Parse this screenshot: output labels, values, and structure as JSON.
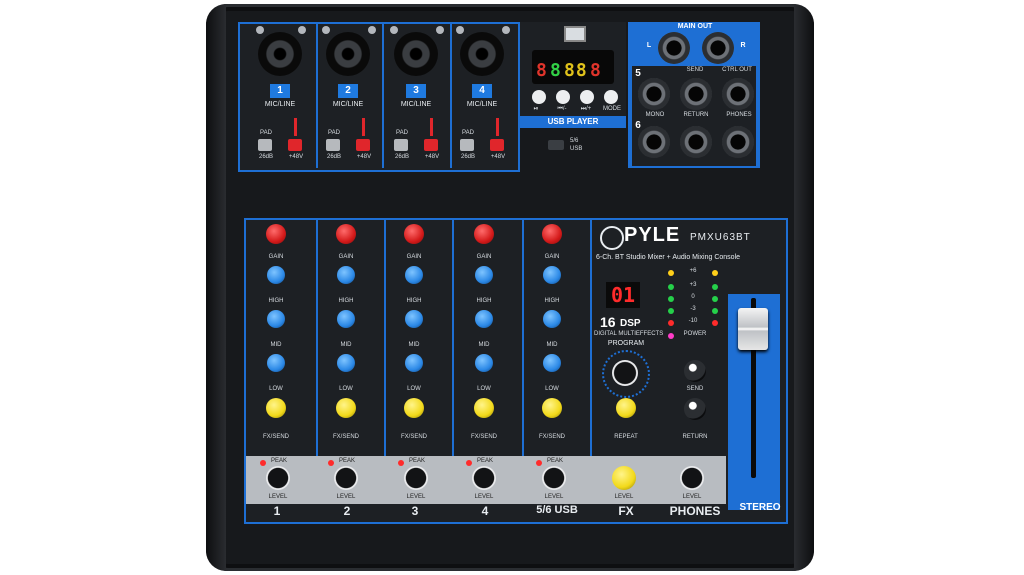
{
  "brand": {
    "logo_text": "PYLE",
    "model": "PMXU63BT",
    "subtitle": "6-Ch. BT Studio Mixer + Audio Mixing Console"
  },
  "channels": [
    {
      "number": "1",
      "type": "MIC/LINE",
      "pad": "PAD",
      "pad_value": "26dB",
      "phantom": "+48V",
      "footer": "1"
    },
    {
      "number": "2",
      "type": "MIC/LINE",
      "pad": "PAD",
      "pad_value": "26dB",
      "phantom": "+48V",
      "footer": "2"
    },
    {
      "number": "3",
      "type": "MIC/LINE",
      "pad": "PAD",
      "pad_value": "26dB",
      "phantom": "+48V",
      "footer": "3"
    },
    {
      "number": "4",
      "type": "MIC/LINE",
      "pad": "PAD",
      "pad_value": "26dB",
      "phantom": "+48V",
      "footer": "4"
    }
  ],
  "strip_labels": {
    "gain": "GAIN",
    "high": "HIGH",
    "mid": "MID",
    "low": "LOW",
    "fx_send": "FX/SEND",
    "peak": "PEAK",
    "level": "LEVEL"
  },
  "footers": {
    "ch56": "5/6 USB",
    "fx": "FX",
    "phones": "PHONES",
    "stereo": "STEREO"
  },
  "usb_player": {
    "title": "USB PLAYER",
    "buttons": [
      "⏯",
      "⏮/-",
      "⏭/+",
      "MODE"
    ],
    "source_5_6": "5/6",
    "source_usb": "USB"
  },
  "io": {
    "main_out": "MAIN OUT",
    "left": "L",
    "right": "R",
    "send": "SEND",
    "ctrl_out": "CTRL OUT",
    "return": "RETURN",
    "phones": "PHONES",
    "mono": "MONO",
    "ch5": "5",
    "ch6": "6"
  },
  "dsp": {
    "display": "01",
    "count": "16",
    "label": "DSP",
    "sub": "DIGITAL MULTIEFFECTS",
    "program": "PROGRAM",
    "repeat": "REPEAT",
    "send": "SEND",
    "return": "RETURN"
  },
  "meter": {
    "marks": [
      "+6",
      "+3",
      "0",
      "-3",
      "-10"
    ],
    "power": "POWER"
  },
  "colors": {
    "accent_blue": "#1e6fd4",
    "knob_red": "#d41a1a",
    "knob_blue": "#2b88e6",
    "knob_yellow": "#f2d91a",
    "body": "#17191c"
  }
}
